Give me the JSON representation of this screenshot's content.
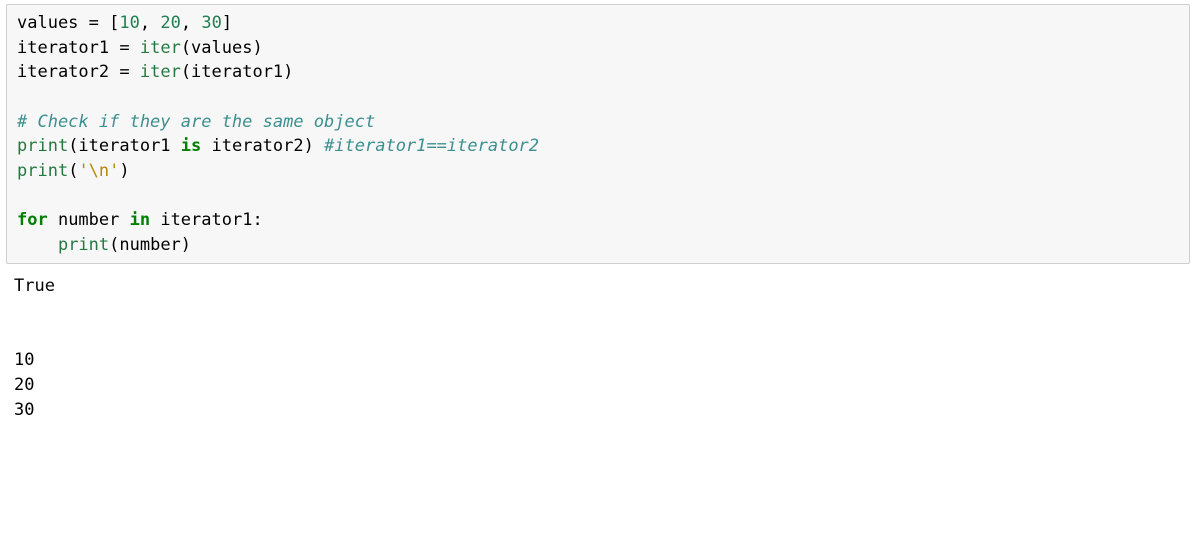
{
  "code": {
    "l1_name1": "values ",
    "l1_op1": "=",
    "l1_sp1": " [",
    "l1_n1": "10",
    "l1_c1": ", ",
    "l1_n2": "20",
    "l1_c2": ", ",
    "l1_n3": "30",
    "l1_close": "]",
    "l2_name1": "iterator1 ",
    "l2_op1": "=",
    "l2_sp1": " ",
    "l2_builtin": "iter",
    "l2_rest": "(values)",
    "l3_name1": "iterator2 ",
    "l3_op1": "=",
    "l3_sp1": " ",
    "l3_builtin": "iter",
    "l3_rest": "(iterator1)",
    "l5_comment": "# Check if they are the same object",
    "l6_builtin": "print",
    "l6_p1": "(iterator1 ",
    "l6_kw": "is",
    "l6_p2": " iterator2) ",
    "l6_comment": "#iterator1==iterator2",
    "l7_builtin": "print",
    "l7_p1": "(",
    "l7_str": "'\\n'",
    "l7_p2": ")",
    "l9_kw1": "for",
    "l9_mid": " number ",
    "l9_kw2": "in",
    "l9_rest": " iterator1:",
    "l10_indent": "    ",
    "l10_builtin": "print",
    "l10_rest": "(number)"
  },
  "output": {
    "line1": "True",
    "blank1": "",
    "blank2": "",
    "line2": "10",
    "line3": "20",
    "line4": "30"
  }
}
